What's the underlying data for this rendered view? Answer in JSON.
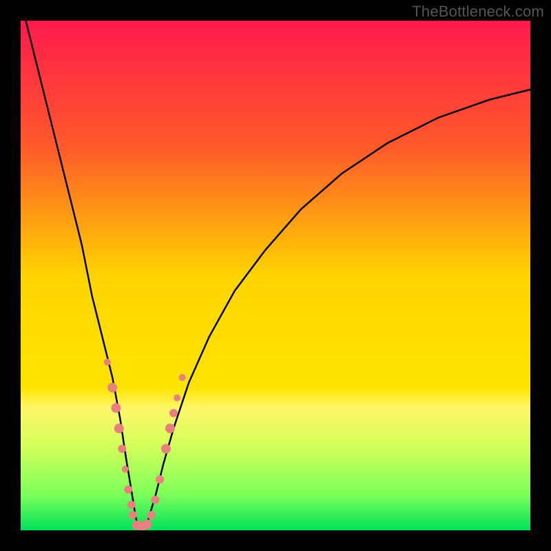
{
  "watermark": "TheBottleneck.com",
  "chart_data": {
    "type": "line",
    "title": "",
    "xlabel": "",
    "ylabel": "",
    "xlim": [
      0,
      100
    ],
    "ylim": [
      0,
      100
    ],
    "grid": false,
    "gradient_stops": [
      {
        "offset": 0,
        "color": "#ff1a4d"
      },
      {
        "offset": 25,
        "color": "#ff5a2a"
      },
      {
        "offset": 50,
        "color": "#ffd400"
      },
      {
        "offset": 72,
        "color": "#ffe400"
      },
      {
        "offset": 76,
        "color": "#fff66a"
      },
      {
        "offset": 83,
        "color": "#d7ff5a"
      },
      {
        "offset": 93,
        "color": "#7dff5a"
      },
      {
        "offset": 100,
        "color": "#00e05a"
      }
    ],
    "series": [
      {
        "name": "bottleneck-curve",
        "stroke": "#000000",
        "stroke_width": 2.5,
        "x": [
          0,
          3,
          6,
          9,
          12,
          14,
          16,
          18,
          19.5,
          20.7,
          21.7,
          22.5,
          23,
          24,
          25,
          26.5,
          28,
          30,
          33,
          37,
          42,
          48,
          55,
          63,
          72,
          82,
          92,
          100
        ],
        "y": [
          104,
          92,
          80,
          68,
          56,
          46,
          38,
          30,
          22,
          14,
          8,
          3,
          0.6,
          0.6,
          2,
          7,
          13,
          20,
          29,
          38,
          47,
          55,
          63,
          70,
          76,
          81,
          84.5,
          86.5
        ]
      }
    ],
    "markers": {
      "name": "data-points",
      "fill": "#e98080",
      "points": [
        {
          "x": 17.0,
          "y": 33,
          "r": 5
        },
        {
          "x": 18.0,
          "y": 28,
          "r": 7
        },
        {
          "x": 18.7,
          "y": 24,
          "r": 7
        },
        {
          "x": 19.3,
          "y": 20,
          "r": 7
        },
        {
          "x": 19.9,
          "y": 16,
          "r": 6
        },
        {
          "x": 20.5,
          "y": 12,
          "r": 5
        },
        {
          "x": 21.1,
          "y": 8,
          "r": 6
        },
        {
          "x": 21.7,
          "y": 5,
          "r": 6
        },
        {
          "x": 22.0,
          "y": 3,
          "r": 6
        },
        {
          "x": 22.8,
          "y": 1.0,
          "r": 7
        },
        {
          "x": 23.8,
          "y": 0.8,
          "r": 7
        },
        {
          "x": 24.8,
          "y": 1.2,
          "r": 7
        },
        {
          "x": 25.6,
          "y": 3,
          "r": 6
        },
        {
          "x": 26.4,
          "y": 6,
          "r": 6
        },
        {
          "x": 27.3,
          "y": 10,
          "r": 6
        },
        {
          "x": 28.5,
          "y": 16,
          "r": 7
        },
        {
          "x": 29.3,
          "y": 20,
          "r": 7
        },
        {
          "x": 30.0,
          "y": 23,
          "r": 6
        },
        {
          "x": 30.7,
          "y": 26,
          "r": 5
        },
        {
          "x": 31.7,
          "y": 30,
          "r": 5
        }
      ]
    }
  }
}
